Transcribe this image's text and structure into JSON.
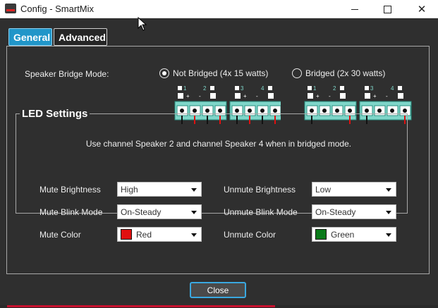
{
  "window": {
    "title": "Config - SmartMix",
    "close_glyph": "✕"
  },
  "tabs": [
    {
      "label": "General",
      "active": true
    },
    {
      "label": "Advanced",
      "active": false
    }
  ],
  "speaker_bridge": {
    "label": "Speaker Bridge Mode:",
    "options": [
      {
        "label": "Not Bridged (4x 15 watts)",
        "checked": true
      },
      {
        "label": "Bridged (2x 30 watts)",
        "checked": false
      }
    ],
    "channels": [
      "1",
      "2",
      "3",
      "4"
    ],
    "note": "Use channel Speaker 2 and channel Speaker 4 when in bridged mode."
  },
  "led_settings": {
    "title": "LED Settings",
    "mute_brightness": {
      "label": "Mute Brightness",
      "value": "High"
    },
    "unmute_brightness": {
      "label": "Unmute Brightness",
      "value": "Low"
    },
    "mute_blink": {
      "label": "Mute Blink Mode",
      "value": "On-Steady"
    },
    "unmute_blink": {
      "label": "Unmute Blink Mode",
      "value": "On-Steady"
    },
    "mute_color": {
      "label": "Mute Color",
      "value": "Red",
      "swatch": "#e01010"
    },
    "unmute_color": {
      "label": "Unmute Color",
      "value": "Green",
      "swatch": "#0a7a1a"
    }
  },
  "footer": {
    "close_label": "Close"
  },
  "colors": {
    "accent": "#2196c9",
    "connector": "#7fd6c9"
  }
}
